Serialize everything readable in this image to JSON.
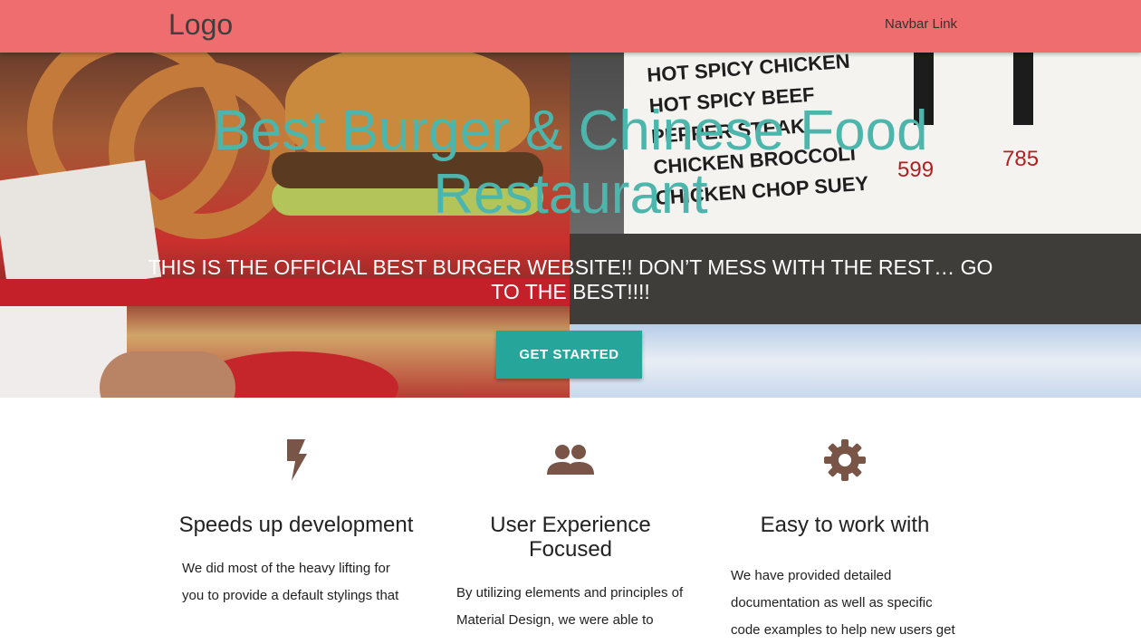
{
  "navbar": {
    "logo": "Logo",
    "link": "Navbar Link"
  },
  "hero": {
    "title": "Best Burger & Chinese Food Restaurant",
    "subtitle": "THIS IS THE OFFICIAL BEST BURGER WEBSITE!! DON’T MESS WITH THE REST… GO TO THE BEST!!!!",
    "cta": "GET STARTED",
    "photo_text": {
      "menu_lines": "HOT SPICY CHICKEN\nHOT SPICY BEEF\nPEPPER STEAK\nCHICKEN BROCCOLI\nCHICKEN CHOP SUEY",
      "price_1": "599",
      "price_2": "785"
    }
  },
  "features": [
    {
      "icon": "flash-icon",
      "title": "Speeds up development",
      "text": "We did most of the heavy lifting for you to provide a default stylings that"
    },
    {
      "icon": "group-icon",
      "title": "User Experience Focused",
      "text": "By utilizing elements and principles of Material Design, we were able to"
    },
    {
      "icon": "gear-icon",
      "title": "Easy to work with",
      "text": "We have provided detailed documentation as well as specific code examples to help new users get"
    }
  ],
  "colors": {
    "navbar": "#ef6d6f",
    "accent": "#26a69a",
    "title": "#4db6ac",
    "icon": "#795548"
  }
}
